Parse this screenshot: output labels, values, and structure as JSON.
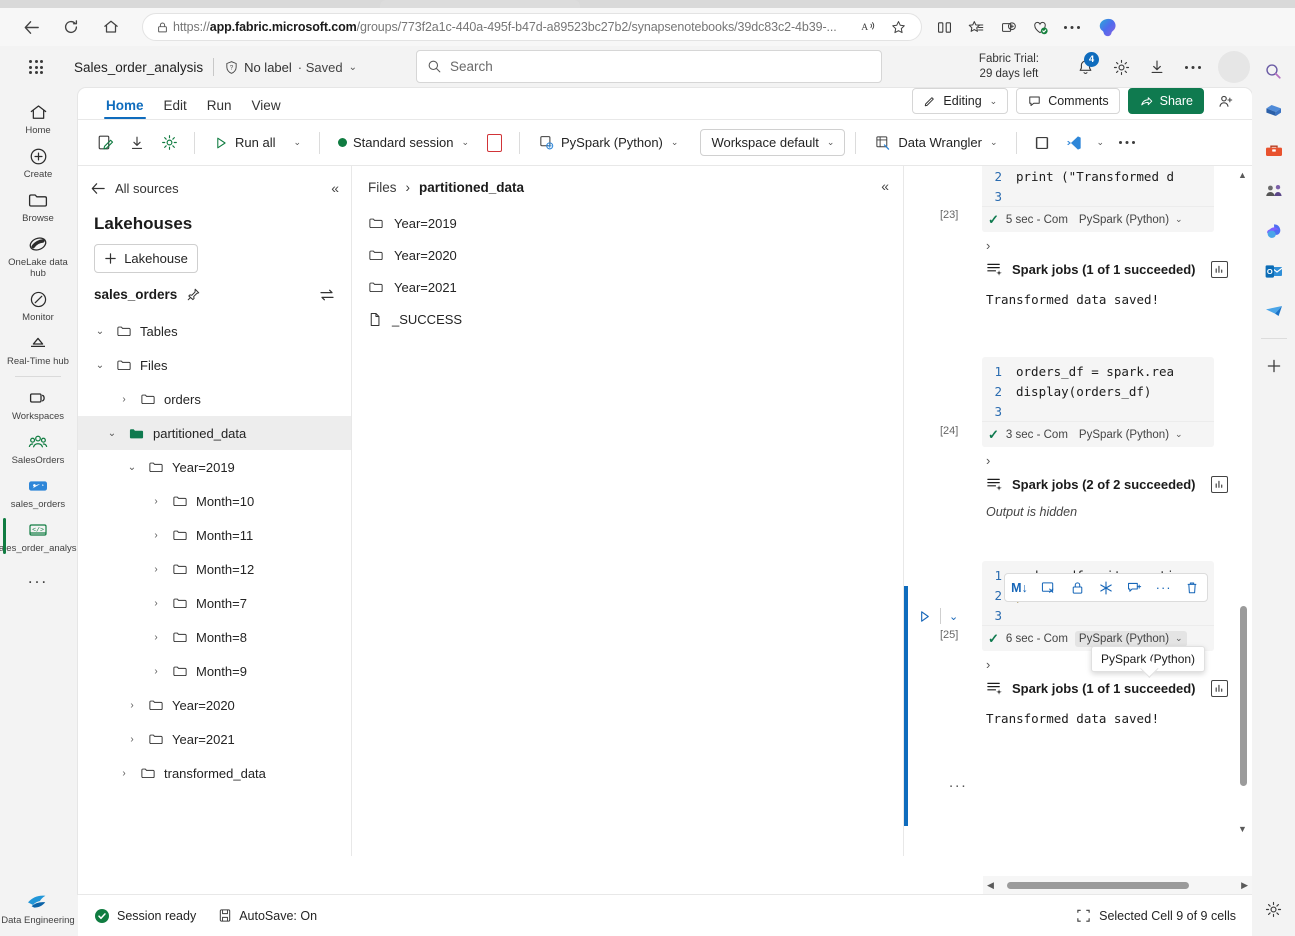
{
  "browser": {
    "url_prefix": "https://",
    "url_bold": "app.fabric.microsoft.com",
    "url_rest": "/groups/773f2a1c-440a-495f-b47d-a89523bc27b2/synapsenotebooks/39dc83c2-4b39-...",
    "back_icon": "back-arrow-icon",
    "refresh_icon": "refresh-icon",
    "home_icon": "home-icon",
    "lock_icon": "lock-icon",
    "read_aloud_icon": "read-aloud-icon",
    "favorite_icon": "star-icon",
    "split_screen_icon": "split-screen-icon",
    "collections_icon": "collections-icon",
    "add_tab_icon": "browser-essentials-icon",
    "heart_icon": "browser-health-icon",
    "settings_icon": "ellipsis-icon",
    "copilot_icon": "copilot-icon"
  },
  "header": {
    "waffle": "app-launcher-icon",
    "doc_title": "Sales_order_analysis",
    "label_icon": "shield-icon",
    "label_text": "No label",
    "saved_text": "· Saved",
    "saved_caret": "⌄",
    "search_placeholder": "Search",
    "search_icon": "search-icon",
    "trial_line1": "Fabric Trial:",
    "trial_line2": "29 days left",
    "notification_count": "4",
    "notification_icon": "bell-icon",
    "settings_icon": "gear-icon",
    "download_icon": "download-icon",
    "more_icon": "ellipsis-icon",
    "avatar": "user-avatar"
  },
  "left_rail": [
    {
      "label": "Home",
      "icon": "home-icon",
      "selected": false
    },
    {
      "label": "Create",
      "icon": "plus-circle-icon",
      "selected": false
    },
    {
      "label": "Browse",
      "icon": "folder-icon",
      "selected": false
    },
    {
      "label": "OneLake data hub",
      "icon": "onelake-icon",
      "selected": false
    },
    {
      "label": "Monitor",
      "icon": "monitor-icon",
      "selected": false
    },
    {
      "label": "Real-Time hub",
      "icon": "realtime-hub-icon",
      "selected": false
    },
    {
      "label": "Workspaces",
      "icon": "workspaces-icon",
      "selected": false
    },
    {
      "label": "SalesOrders",
      "icon": "people-icon",
      "selected": false
    },
    {
      "label": "sales_orders",
      "icon": "lakehouse-icon",
      "selected": false
    },
    {
      "label": "Sales_order_analysis",
      "icon": "notebook-code-icon",
      "selected": true
    }
  ],
  "left_rail_more": "...",
  "left_rail_bottom": {
    "label": "Data Engineering",
    "icon": "data-engineering-icon"
  },
  "ribbon": {
    "tabs": [
      {
        "label": "Home",
        "active": true
      },
      {
        "label": "Edit",
        "active": false
      },
      {
        "label": "Run",
        "active": false
      },
      {
        "label": "View",
        "active": false
      }
    ],
    "editing_label": "Editing",
    "editing_icon": "pencil-icon",
    "comments_label": "Comments",
    "comments_icon": "comment-icon",
    "share_label": "Share",
    "share_icon": "share-icon",
    "share_color": "#0f7a4f",
    "people_icon": "add-person-icon",
    "save_icon": "save-notebook-icon",
    "import_icon": "download-icon",
    "settings_icon": "notebook-settings-icon",
    "run_all_label": "Run all",
    "run_all_icon": "play-icon",
    "session_label": "Standard session",
    "session_dot_color": "#107c41",
    "stop_icon": "stop-icon",
    "language_label": "PySpark (Python)",
    "language_icon": "pyspark-icon",
    "environment_label": "Workspace default",
    "data_wrangler_label": "Data Wrangler",
    "data_wrangler_icon": "data-wrangler-icon",
    "view_icon": "layout-icon",
    "vscode_icon": "vscode-icon",
    "more_icon": "ellipsis-icon"
  },
  "explorer": {
    "back_label": "All sources",
    "back_icon": "back-arrow-icon",
    "collapse_icon": "collapse-left-icon",
    "heading": "Lakehouses",
    "add_lakehouse_label": "Lakehouse",
    "add_icon": "plus-icon",
    "lakehouse_name": "sales_orders",
    "pin_icon": "pin-icon",
    "swap_icon": "swap-icon",
    "tree": [
      {
        "label": "Tables",
        "depth": 0,
        "chev": "⌄",
        "icon": "folder-icon",
        "selected": false
      },
      {
        "label": "Files",
        "depth": 0,
        "chev": "⌄",
        "icon": "folder-icon",
        "selected": false
      },
      {
        "label": "orders",
        "depth": 1,
        "chev": "›",
        "icon": "folder-icon",
        "selected": false
      },
      {
        "label": "partitioned_data",
        "depth": 1,
        "chev": "⌄",
        "icon": "folder-open-green-icon",
        "selected": true
      },
      {
        "label": "Year=2019",
        "depth": 2,
        "chev": "⌄",
        "icon": "folder-icon",
        "selected": false
      },
      {
        "label": "Month=10",
        "depth": 3,
        "chev": "›",
        "icon": "folder-icon",
        "selected": false
      },
      {
        "label": "Month=11",
        "depth": 3,
        "chev": "›",
        "icon": "folder-icon",
        "selected": false
      },
      {
        "label": "Month=12",
        "depth": 3,
        "chev": "›",
        "icon": "folder-icon",
        "selected": false
      },
      {
        "label": "Month=7",
        "depth": 3,
        "chev": "›",
        "icon": "folder-icon",
        "selected": false
      },
      {
        "label": "Month=8",
        "depth": 3,
        "chev": "›",
        "icon": "folder-icon",
        "selected": false
      },
      {
        "label": "Month=9",
        "depth": 3,
        "chev": "›",
        "icon": "folder-icon",
        "selected": false
      },
      {
        "label": "Year=2020",
        "depth": 2,
        "chev": "›",
        "icon": "folder-icon",
        "selected": false
      },
      {
        "label": "Year=2021",
        "depth": 2,
        "chev": "›",
        "icon": "folder-icon",
        "selected": false
      },
      {
        "label": "transformed_data",
        "depth": 1,
        "chev": "›",
        "icon": "folder-icon",
        "selected": false
      }
    ]
  },
  "files_pane": {
    "crumb_root": "Files",
    "crumb_sep": "›",
    "crumb_current": "partitioned_data",
    "collapse_icon": "collapse-left-icon",
    "rows": [
      {
        "label": "Year=2019",
        "icon": "folder-icon"
      },
      {
        "label": "Year=2020",
        "icon": "folder-icon"
      },
      {
        "label": "Year=2021",
        "icon": "folder-icon"
      },
      {
        "label": "_SUCCESS",
        "icon": "file-icon"
      }
    ]
  },
  "notebook": {
    "cells": [
      {
        "exec": "[23]",
        "lines": [
          {
            "n": "2",
            "text": "print (\"Transformed d"
          },
          {
            "n": "3",
            "text": ""
          }
        ],
        "duration": "5 sec - Com",
        "language": "PySpark (Python)",
        "status_icon": "success-check-icon"
      },
      {
        "exec": "[24]",
        "lines": [
          {
            "n": "1",
            "text": "orders_df = spark.rea"
          },
          {
            "n": "2",
            "text": "display(orders_df)"
          },
          {
            "n": "3",
            "text": ""
          }
        ],
        "duration": "3 sec - Com",
        "language": "PySpark (Python)",
        "status_icon": "success-check-icon"
      },
      {
        "exec": "[25]",
        "lines": [
          {
            "n": "1",
            "text": "orders_df.write.parti"
          },
          {
            "n": "2",
            "text": "print "
          },
          {
            "n": "3",
            "text": ""
          }
        ],
        "duration": "6 sec - Com",
        "language": "PySpark (Python)",
        "status_icon": "success-check-icon"
      }
    ],
    "outputs": {
      "spark_jobs_1": "Spark jobs (1 of 1 succeeded)",
      "output_1": "Transformed data saved!",
      "spark_jobs_2": "Spark jobs (2 of 2 succeeded)",
      "output_2": "Output is hidden",
      "spark_jobs_3": "Spark jobs (1 of 1 succeeded)",
      "output_3": "Transformed data saved!",
      "chart_icon": "bar-chart-icon",
      "jobs_icon": "spark-jobs-icon",
      "expand_chevron": "›",
      "more_dots": "..."
    },
    "cell_toolbar": [
      {
        "icon": "markdown-icon",
        "glyph": "M↓"
      },
      {
        "icon": "clear-output-icon",
        "glyph": ""
      },
      {
        "icon": "lock-icon",
        "glyph": ""
      },
      {
        "icon": "freeze-icon",
        "glyph": ""
      },
      {
        "icon": "add-comment-icon",
        "glyph": ""
      },
      {
        "icon": "more-options-icon",
        "glyph": "···"
      },
      {
        "icon": "delete-icon",
        "glyph": ""
      }
    ],
    "tooltip": "PySpark (Python)",
    "run_icon": "play-icon",
    "collapse_icon": "chevron-down-icon"
  },
  "statusbar": {
    "session_text": "Session ready",
    "session_icon": "success-check-icon",
    "autosave_text": "AutoSave: On",
    "autosave_icon": "save-icon",
    "selection_text": "Selected Cell 9 of 9 cells",
    "selection_icon": "cell-selection-icon"
  },
  "right_rail": [
    {
      "icon": "search-icon"
    },
    {
      "icon": "tag-icon"
    },
    {
      "icon": "toolbox-icon"
    },
    {
      "icon": "people-meeting-icon"
    },
    {
      "icon": "onedrive-icon"
    },
    {
      "icon": "outlook-icon"
    },
    {
      "icon": "paper-plane-icon"
    }
  ],
  "right_rail_add": "+",
  "right_rail_settings": "gear-icon"
}
